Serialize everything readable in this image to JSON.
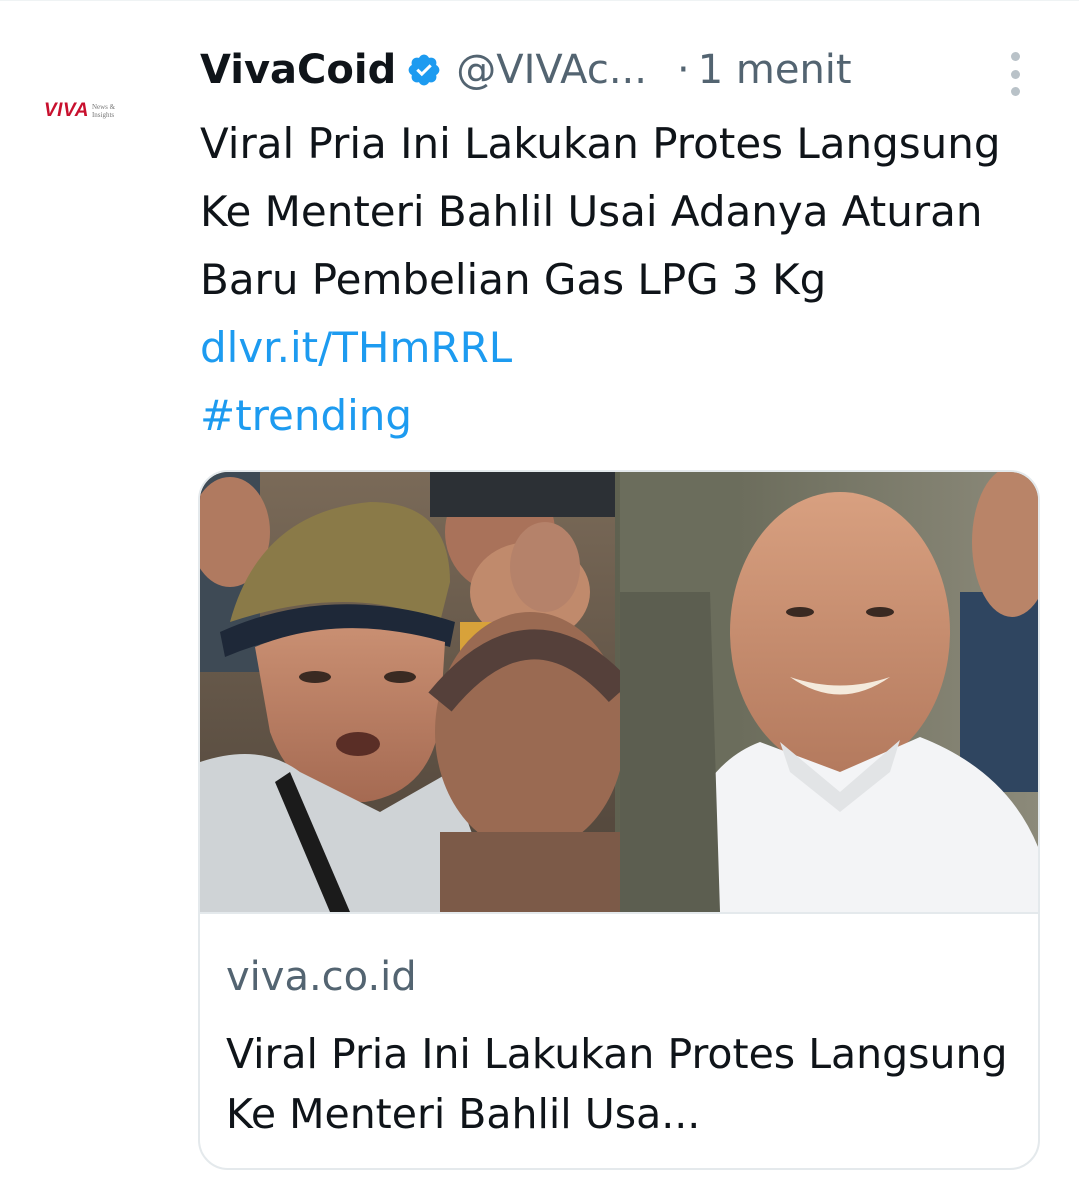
{
  "author": {
    "display_name": "VivaCoid",
    "handle": "@VIVAc...",
    "separator": "·",
    "timestamp": "1 menit",
    "avatar_logo": "VIVA",
    "avatar_tagline_1": "News &",
    "avatar_tagline_2": "Insights",
    "verified_icon": "verified-badge-icon",
    "verified_color": "#1d9bf0"
  },
  "tweet": {
    "text": "Viral Pria Ini Lakukan Protes Langsung Ke Menteri Bahlil Usai Adanya Aturan Baru Pembelian Gas LPG 3 Kg",
    "link": "dlvr.it/THmRRL",
    "hashtag": "#trending",
    "link_color": "#1d9bf0"
  },
  "card": {
    "domain": "viva.co.id",
    "title": "Viral Pria Ini Lakukan Protes Langsung Ke Menteri Bahlil Usa..."
  },
  "menu": {
    "icon": "more-vertical-icon"
  }
}
